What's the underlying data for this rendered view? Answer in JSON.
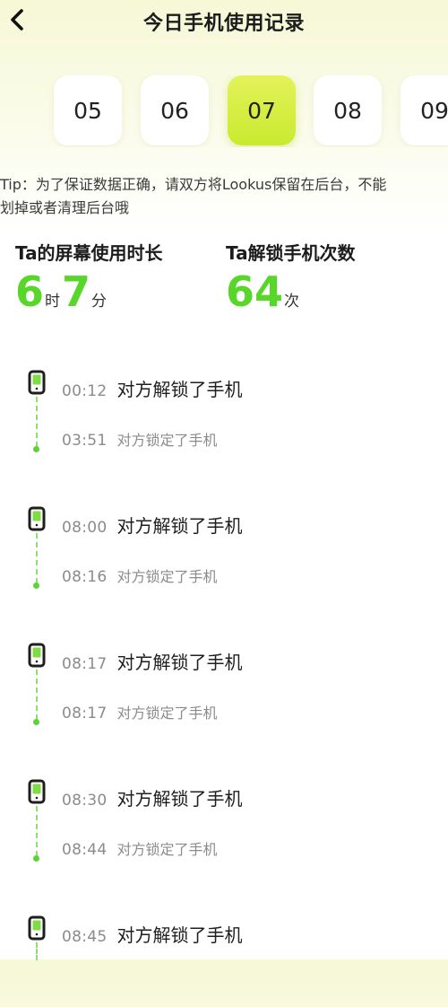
{
  "header": {
    "title": "今日手机使用记录",
    "back_icon": "chevron-left-icon"
  },
  "dates": [
    {
      "label": "05",
      "selected": false
    },
    {
      "label": "06",
      "selected": false
    },
    {
      "label": "07",
      "selected": true
    },
    {
      "label": "08",
      "selected": false
    },
    {
      "label": "09",
      "selected": false
    }
  ],
  "tip": "Tip：为了保证数据正确，请双方将Lookus保留在后台，不能\n划掉或者清理后台哦",
  "stats": {
    "screen_time": {
      "label": "Ta的屏幕使用时长",
      "hours": "6",
      "hours_unit": "时",
      "minutes": "7",
      "minutes_unit": "分"
    },
    "unlocks": {
      "label": "Ta解锁手机次数",
      "count": "64",
      "count_unit": "次"
    }
  },
  "timeline": [
    {
      "unlock_time": "00:12",
      "unlock_text": "对方解锁了手机",
      "lock_time": "03:51",
      "lock_text": "对方锁定了手机"
    },
    {
      "unlock_time": "08:00",
      "unlock_text": "对方解锁了手机",
      "lock_time": "08:16",
      "lock_text": "对方锁定了手机"
    },
    {
      "unlock_time": "08:17",
      "unlock_text": "对方解锁了手机",
      "lock_time": "08:17",
      "lock_text": "对方锁定了手机"
    },
    {
      "unlock_time": "08:30",
      "unlock_text": "对方解锁了手机",
      "lock_time": "08:44",
      "lock_text": "对方锁定了手机"
    },
    {
      "unlock_time": "08:45",
      "unlock_text": "对方解锁了手机",
      "lock_time": "",
      "lock_text": ""
    }
  ],
  "colors": {
    "accent_green": "#58d62a",
    "selected_chip": "#d6ee45",
    "muted_text": "#8b8b8b"
  }
}
